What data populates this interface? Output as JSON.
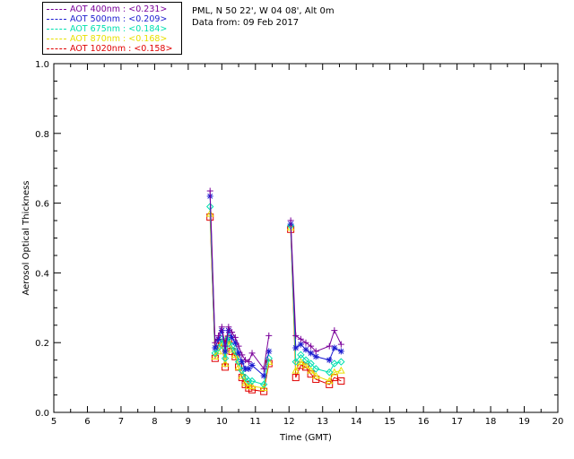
{
  "header": {
    "station": "PML, N 50 22', W 04 08', Alt 0m",
    "date": "Data from: 09 Feb 2017"
  },
  "legend": [
    {
      "label": "AOT  400nm : <0.231>",
      "color": "#7a009a"
    },
    {
      "label": "AOT  500nm : <0.209>",
      "color": "#1b1bd0"
    },
    {
      "label": "AOT  675nm : <0.184>",
      "color": "#00e0b0"
    },
    {
      "label": "AOT  870nm : <0.168>",
      "color": "#e8e000"
    },
    {
      "label": "AOT 1020nm : <0.158>",
      "color": "#e00000"
    }
  ],
  "chart_data": {
    "type": "line",
    "xlabel": "Time (GMT)",
    "ylabel": "Aerosol Optical Thickness",
    "xlim": [
      5,
      20
    ],
    "ylim": [
      0.0,
      1.0
    ],
    "x_ticks": [
      "5",
      "6",
      "7",
      "8",
      "9",
      "10",
      "11",
      "12",
      "13",
      "14",
      "15",
      "16",
      "17",
      "18",
      "19",
      "20"
    ],
    "y_ticks": [
      "0.0",
      "0.2",
      "0.4",
      "0.6",
      "0.8",
      "1.0"
    ],
    "x": [
      9.65,
      9.8,
      9.9,
      10.0,
      10.1,
      10.2,
      10.3,
      10.4,
      10.5,
      10.6,
      10.7,
      10.8,
      10.9,
      11.25,
      11.4,
      12.05,
      12.2,
      12.35,
      12.5,
      12.65,
      12.8,
      13.2,
      13.35,
      13.55
    ],
    "series": [
      {
        "name": "AOT  400nm",
        "color": "#7a009a",
        "marker": "plus",
        "values": [
          0.635,
          0.2,
          0.22,
          0.245,
          0.19,
          0.245,
          0.23,
          0.215,
          0.19,
          0.165,
          0.15,
          0.145,
          0.17,
          0.125,
          0.22,
          0.55,
          0.22,
          0.21,
          0.2,
          0.19,
          0.175,
          0.19,
          0.235,
          0.195
        ]
      },
      {
        "name": "AOT  500nm",
        "color": "#1b1bd0",
        "marker": "star",
        "values": [
          0.62,
          0.185,
          0.21,
          0.235,
          0.175,
          0.235,
          0.215,
          0.2,
          0.17,
          0.145,
          0.125,
          0.125,
          0.135,
          0.105,
          0.175,
          0.54,
          0.185,
          0.195,
          0.18,
          0.17,
          0.16,
          0.15,
          0.185,
          0.175
        ]
      },
      {
        "name": "AOT  675nm",
        "color": "#00e0b0",
        "marker": "diamond",
        "values": [
          0.59,
          0.17,
          0.185,
          0.21,
          0.155,
          0.215,
          0.19,
          0.175,
          0.145,
          0.12,
          0.1,
          0.09,
          0.09,
          0.08,
          0.155,
          0.535,
          0.145,
          0.165,
          0.15,
          0.14,
          0.125,
          0.115,
          0.14,
          0.145
        ]
      },
      {
        "name": "AOT  870nm",
        "color": "#e8e000",
        "marker": "triangle",
        "values": [
          0.57,
          0.16,
          0.175,
          0.2,
          0.14,
          0.205,
          0.18,
          0.165,
          0.13,
          0.105,
          0.085,
          0.075,
          0.075,
          0.07,
          0.145,
          0.53,
          0.12,
          0.145,
          0.135,
          0.12,
          0.105,
          0.09,
          0.115,
          0.12
        ]
      },
      {
        "name": "AOT 1020nm",
        "color": "#e00000",
        "marker": "square",
        "values": [
          0.56,
          0.155,
          0.2,
          0.2,
          0.13,
          0.21,
          0.175,
          0.16,
          0.13,
          0.1,
          0.08,
          0.07,
          0.065,
          0.06,
          0.14,
          0.525,
          0.1,
          0.135,
          0.13,
          0.11,
          0.095,
          0.08,
          0.1,
          0.09
        ]
      }
    ]
  }
}
